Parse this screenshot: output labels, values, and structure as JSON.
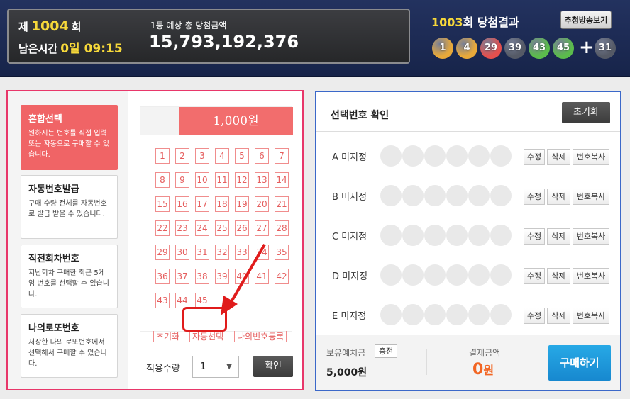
{
  "header": {
    "round_prefix": "제",
    "round_number": "1004",
    "round_suffix": "회",
    "time_label": "남은시간",
    "time_value": "0일 09:15",
    "prize_label": "1등 예상 총 당첨금액",
    "prize_amount": "15,793,192,376",
    "result_round": "1003",
    "result_suffix": "회 당첨결과",
    "broadcast_button": "추첨방송보기",
    "balls": [
      {
        "n": "1",
        "color": "#e8a93a"
      },
      {
        "n": "4",
        "color": "#e8a93a"
      },
      {
        "n": "29",
        "color": "#e4504e"
      },
      {
        "n": "39",
        "color": "#555a66"
      },
      {
        "n": "43",
        "color": "#5bbb4c"
      },
      {
        "n": "45",
        "color": "#5bbb4c"
      }
    ],
    "bonus_ball": {
      "n": "31",
      "color": "#555a66"
    }
  },
  "modes": [
    {
      "title": "혼합선택",
      "desc": "원하시는 번호를 직접 입력 또는 자동으로 구매할 수 있습니다.",
      "active": true
    },
    {
      "title": "자동번호발급",
      "desc": "구매 수량 전체를 자동번호로 발급 받을 수 있습니다.",
      "active": false
    },
    {
      "title": "직전회차번호",
      "desc": "지난회차 구매한 최근 5게임 번호를 선택할 수 있습니다.",
      "active": false
    },
    {
      "title": "나의로또번호",
      "desc": "저장한 나의 로또번호에서 선택해서 구매할 수 있습니다.",
      "active": false
    }
  ],
  "slip": {
    "price": "1,000원",
    "numbers": [
      "1",
      "2",
      "3",
      "4",
      "5",
      "6",
      "7",
      "8",
      "9",
      "10",
      "11",
      "12",
      "13",
      "14",
      "15",
      "16",
      "17",
      "18",
      "19",
      "20",
      "21",
      "22",
      "23",
      "24",
      "25",
      "26",
      "27",
      "28",
      "29",
      "30",
      "31",
      "32",
      "33",
      "34",
      "35",
      "36",
      "37",
      "38",
      "39",
      "40",
      "41",
      "42",
      "43",
      "44",
      "45"
    ],
    "reset": "초기화",
    "auto": "자동선택",
    "my_numbers": "나의번호등록"
  },
  "quantity": {
    "label": "적용수량",
    "value": "1",
    "confirm": "확인"
  },
  "selection": {
    "title": "선택번호 확인",
    "reset": "초기화",
    "rows": [
      {
        "label": "A 미지정"
      },
      {
        "label": "B 미지정"
      },
      {
        "label": "C 미지정"
      },
      {
        "label": "D 미지정"
      },
      {
        "label": "E 미지정"
      }
    ],
    "btn_edit": "수정",
    "btn_delete": "삭제",
    "btn_copy": "번호복사"
  },
  "footer": {
    "balance_label": "보유예치금",
    "charge": "충전",
    "balance": "5,000원",
    "pay_label": "결제금액",
    "pay_amount": "0",
    "pay_unit": "원",
    "buy": "구매하기"
  }
}
